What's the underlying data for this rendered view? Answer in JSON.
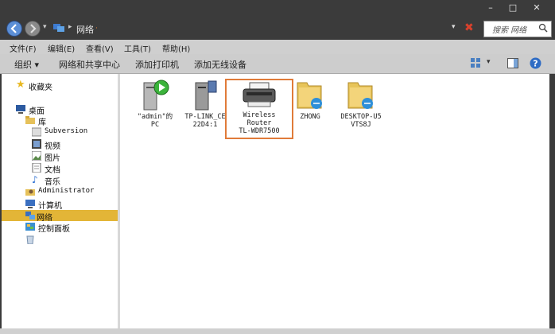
{
  "address": {
    "path": "网络"
  },
  "search": {
    "placeholder": "搜索 网络"
  },
  "menu": {
    "file": "文件(F)",
    "edit": "编辑(E)",
    "view": "查看(V)",
    "tools": "工具(T)",
    "help": "帮助(H)"
  },
  "toolbar": {
    "organize": "组织 ▾",
    "network_center": "网络和共享中心",
    "add_printer": "添加打印机",
    "add_wireless": "添加无线设备"
  },
  "sidebar": {
    "favorites": "收藏夹",
    "desktop": "桌面",
    "library": "库",
    "subversion": "Subversion",
    "videos": "视频",
    "pictures": "图片",
    "documents": "文档",
    "music": "音乐",
    "administrator": "Administrator",
    "computer": "计算机",
    "network": "网络",
    "control_panel": "控制面板"
  },
  "files": [
    {
      "name": "\"admin\"的\nPC",
      "icon": "media-device-icon"
    },
    {
      "name": "TP-LINK_CE\n22D4:1",
      "icon": "media-server-icon"
    },
    {
      "name": "Wireless\nRouter\nTL-WDR7500",
      "icon": "router-icon"
    },
    {
      "name": "ZHONG",
      "icon": "folder-computer-icon"
    },
    {
      "name": "DESKTOP-U5\nVTS8J",
      "icon": "folder-computer-icon"
    }
  ]
}
